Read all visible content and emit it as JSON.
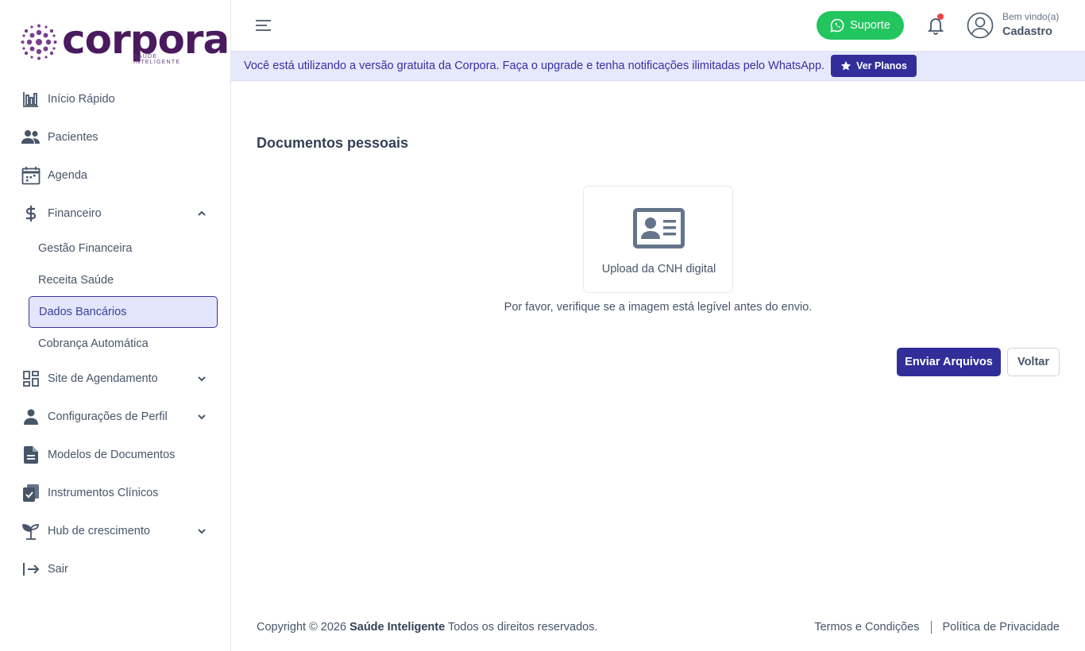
{
  "brand": {
    "name": "corpora",
    "tagline": "SAÚDE INTELIGENTE",
    "primary_color": "#312e9a",
    "logo_color": "#4a1a5e"
  },
  "sidebar": {
    "items": [
      {
        "label": "Início Rápido",
        "icon": "bar-chart-icon"
      },
      {
        "label": "Pacientes",
        "icon": "users-icon"
      },
      {
        "label": "Agenda",
        "icon": "calendar-icon"
      },
      {
        "label": "Financeiro",
        "icon": "dollar-icon",
        "expanded": true,
        "children": [
          {
            "label": "Gestão Financeira"
          },
          {
            "label": "Receita Saúde"
          },
          {
            "label": "Dados Bancários",
            "active": true
          },
          {
            "label": "Cobrança Automática"
          }
        ]
      },
      {
        "label": "Site de Agendamento",
        "icon": "grid-icon"
      },
      {
        "label": "Configurações de Perfil",
        "icon": "user-icon"
      },
      {
        "label": "Modelos de Documentos",
        "icon": "document-icon"
      },
      {
        "label": "Instrumentos Clínicos",
        "icon": "clipboard-check-icon"
      },
      {
        "label": "Hub de crescimento",
        "icon": "seedling-icon"
      },
      {
        "label": "Sair",
        "icon": "logout-icon"
      }
    ]
  },
  "header": {
    "support_label": "Suporte",
    "welcome": "Bem vindo(a)",
    "username": "Cadastro",
    "support_color": "#22c55e",
    "notification_dot_color": "#ef4444"
  },
  "banner": {
    "text": "Você está utilizando a versão gratuita da Corpora. Faça o upgrade e tenha notificações ilimitadas pelo WhatsApp.",
    "button_label": "Ver Planos"
  },
  "main": {
    "section_title": "Documentos pessoais",
    "upload_label": "Upload da CNH digital",
    "hint": "Por favor, verifique se a imagem está legível antes do envio.",
    "send_label": "Enviar Arquivos",
    "back_label": "Voltar"
  },
  "footer": {
    "copyright_prefix": "Copyright © 2026",
    "company": "Saúde Inteligente",
    "rights": "Todos os direitos reservados.",
    "terms": "Termos e Condições",
    "privacy": "Política de Privacidade"
  }
}
